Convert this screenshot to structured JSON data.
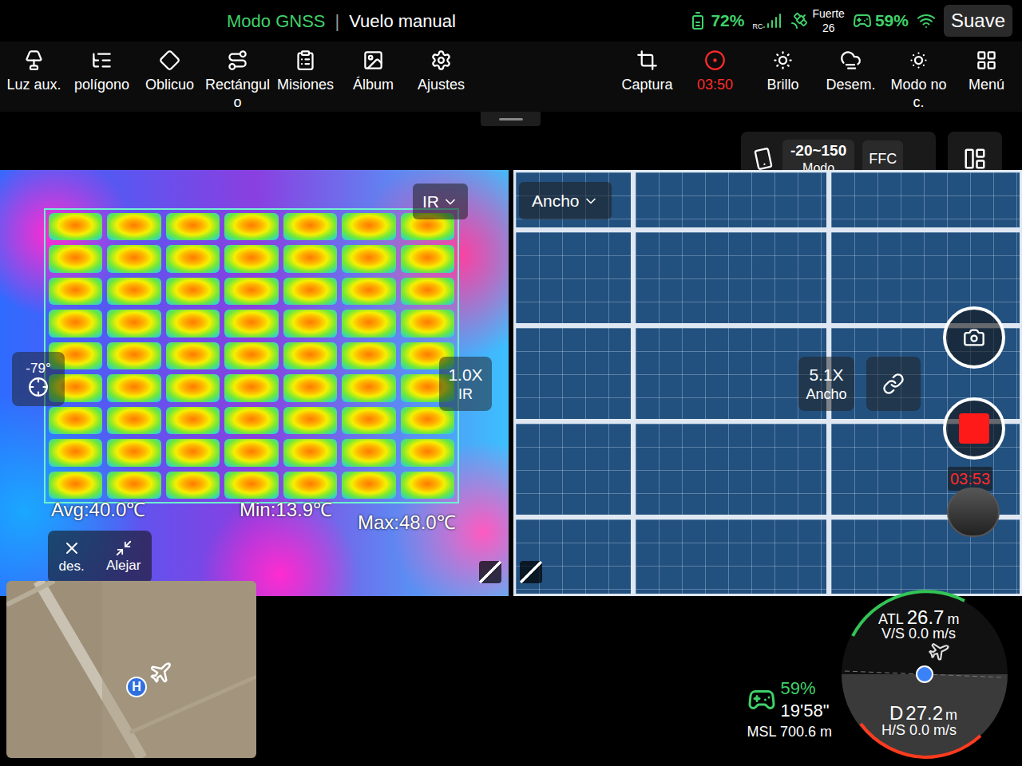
{
  "status_bar": {
    "mode": "Modo GNSS",
    "separator": "|",
    "flight": "Vuelo manual",
    "rc_battery": "72%",
    "rc_label": "RC",
    "gps_label": "Fuerte",
    "satellites": "26",
    "drone_battery": "59%",
    "gear": "Suave"
  },
  "toolbar_left": [
    {
      "label": "Luz aux."
    },
    {
      "label": "polígono"
    },
    {
      "label": "Oblicuo"
    },
    {
      "label": "Rectángulo"
    },
    {
      "label": "Misiones"
    },
    {
      "label": "Álbum"
    },
    {
      "label": "Ajustes"
    }
  ],
  "toolbar_right": [
    {
      "label": "Captura",
      "recording": false
    },
    {
      "label": "03:50",
      "recording": true
    },
    {
      "label": "Brillo",
      "recording": false
    },
    {
      "label": "Desem.",
      "recording": false
    },
    {
      "label": "Modo noc.",
      "recording": false
    },
    {
      "label": "Menú",
      "recording": false
    }
  ],
  "camera_controls": {
    "range": "-20~150",
    "range_label": "Modo",
    "ffc": "FFC"
  },
  "thermal_view": {
    "mode": "IR",
    "zoom": "1.0X",
    "zoom_label": "IR",
    "gimbal": "-79°",
    "avg": "Avg:40.0℃",
    "min": "Min:13.9℃",
    "max": "Max:48.0℃",
    "close": "des.",
    "zoom_out": "Alejar"
  },
  "wide_view": {
    "mode": "Ancho",
    "zoom": "5.1X",
    "zoom_label": "Ancho"
  },
  "record": {
    "elapsed": "03:53",
    "recording": true
  },
  "telemetry": {
    "battery": "59%",
    "flight_time": "19'58\"",
    "msl": "MSL 700.6 m",
    "atl_label": "ATL",
    "atl": "26.7",
    "atl_unit": "m",
    "vs": "V/S 0.0 m/s",
    "d_label": "D",
    "d": "27.2",
    "d_unit": "m",
    "hs": "H/S 0.0 m/s"
  },
  "map": {
    "home_marker": "H"
  }
}
